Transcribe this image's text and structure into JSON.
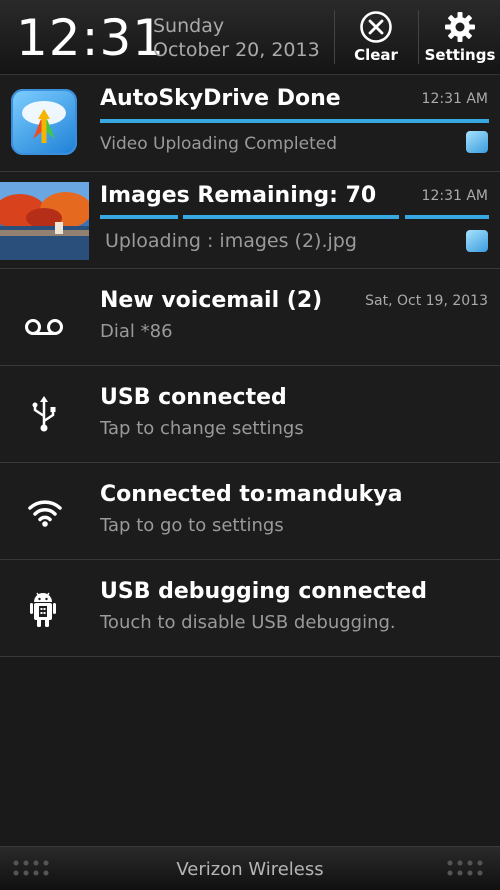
{
  "status": {
    "time": "12:31",
    "day": "Sunday",
    "date": "October 20, 2013",
    "clear_label": "Clear",
    "settings_label": "Settings"
  },
  "notifications": [
    {
      "title": "AutoSkyDrive Done",
      "time": "12:31 AM",
      "subtitle": "Video Uploading Completed",
      "icon": "autoskydrive-icon",
      "progress": 1.0
    },
    {
      "title": "Images Remaining: 70",
      "time": "12:31 AM",
      "subtitle": "Uploading : images (2).jpg",
      "icon": "image-thumbnail"
    },
    {
      "title": "New voicemail (2)",
      "time": "Sat, Oct 19, 2013",
      "subtitle": "Dial *86",
      "icon": "voicemail-icon"
    },
    {
      "title": "USB connected",
      "subtitle": "Tap to change settings",
      "icon": "usb-icon"
    },
    {
      "title": "Connected to:mandukya",
      "subtitle": "Tap to go to settings",
      "icon": "wifi-icon"
    },
    {
      "title": "USB debugging connected",
      "subtitle": "Touch to disable USB debugging.",
      "icon": "android-debug-icon"
    }
  ],
  "footer": {
    "carrier": "Verizon Wireless"
  },
  "colors": {
    "accent": "#37a8e0",
    "background": "#1a1a1a"
  }
}
